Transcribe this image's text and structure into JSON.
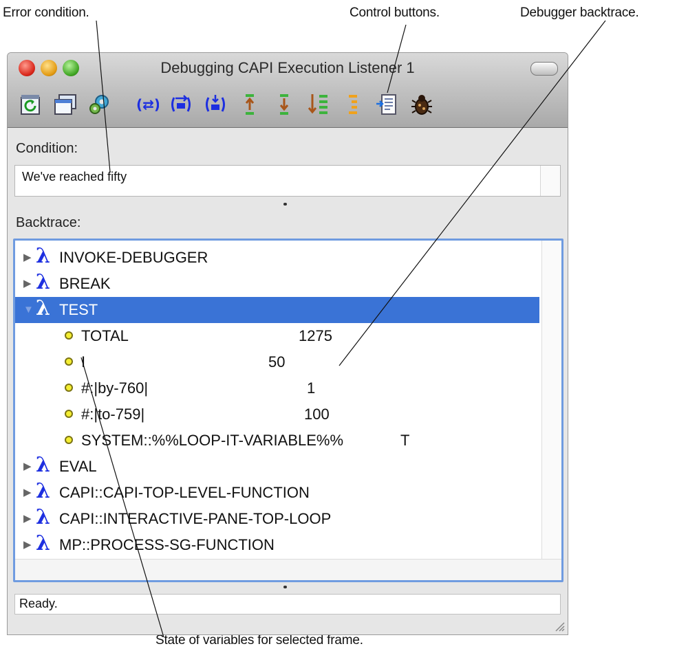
{
  "callouts": {
    "error_condition": "Error condition.",
    "control_buttons": "Control buttons.",
    "debugger_backtrace": "Debugger backtrace.",
    "state_of_variables": "State of variables for selected frame."
  },
  "window": {
    "title": "Debugging CAPI Execution Listener 1",
    "toolbar": {
      "buttons": [
        "refresh-icon",
        "window-icon",
        "gears-icon",
        "restart-icon",
        "step-over-icon",
        "step-into-icon",
        "frame-up-icon",
        "frame-down-icon",
        "frame-list-icon",
        "frame-list-alt-icon",
        "edit-source-icon",
        "bug-icon"
      ]
    }
  },
  "condition": {
    "label": "Condition:",
    "text": "We've reached fifty"
  },
  "backtrace": {
    "label": "Backtrace:",
    "frames": [
      {
        "name": "INVOKE-DEBUGGER"
      },
      {
        "name": "BREAK"
      },
      {
        "name": "TEST",
        "selected": true,
        "variables": [
          {
            "name": "TOTAL",
            "value": "1275"
          },
          {
            "name": "I",
            "value": "50"
          },
          {
            "name": "#:|by-760|",
            "value": "1"
          },
          {
            "name": "#:|to-759|",
            "value": "100"
          },
          {
            "name": "SYSTEM::%%LOOP-IT-VARIABLE%%",
            "value": "T"
          }
        ]
      },
      {
        "name": "EVAL"
      },
      {
        "name": "CAPI::CAPI-TOP-LEVEL-FUNCTION"
      },
      {
        "name": "CAPI::INTERACTIVE-PANE-TOP-LOOP"
      },
      {
        "name": "MP::PROCESS-SG-FUNCTION"
      }
    ]
  },
  "status": {
    "text": "Ready."
  },
  "colors": {
    "selection": "#3a73d6",
    "lambda": "#1d2fe0",
    "focus_ring": "#6f9be0",
    "variable_dot": "#f4ee32"
  }
}
